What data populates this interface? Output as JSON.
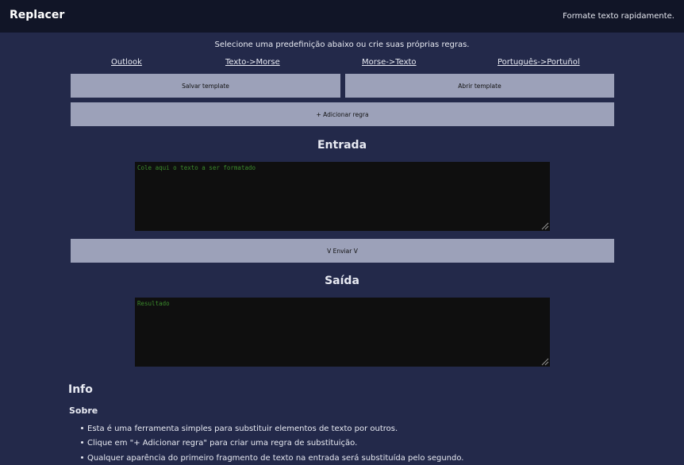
{
  "header": {
    "title": "Replacer",
    "tagline": "Formate texto rapidamente."
  },
  "intro": "Selecione uma predefinição abaixo ou crie suas próprias regras.",
  "presets": [
    "Outlook",
    "Texto->Morse",
    "Morse->Texto",
    "Português->Portuñol"
  ],
  "buttons": {
    "save_template": "Salvar template",
    "open_template": "Abrir template",
    "add_rule": "+ Adicionar regra",
    "send": "V Enviar V"
  },
  "input": {
    "heading": "Entrada",
    "placeholder": "Cole aqui o texto a ser formatado"
  },
  "output": {
    "heading": "Saída",
    "placeholder": "Resultado"
  },
  "info": {
    "heading": "Info",
    "about_heading": "Sobre",
    "items": [
      "Esta é uma ferramenta simples para substituir elementos de texto por outros.",
      "Clique em \"+ Adicionar regra\" para criar uma regra de substituição.",
      "Qualquer aparência do primeiro fragmento de texto na entrada será substituída pelo segundo."
    ]
  },
  "colors": {
    "page_background": "#23294a",
    "header_background": "#111527",
    "button_background": "#9ca1b9",
    "textbox_background": "#0f0f0f",
    "placeholder_text": "#3b8a2c"
  }
}
